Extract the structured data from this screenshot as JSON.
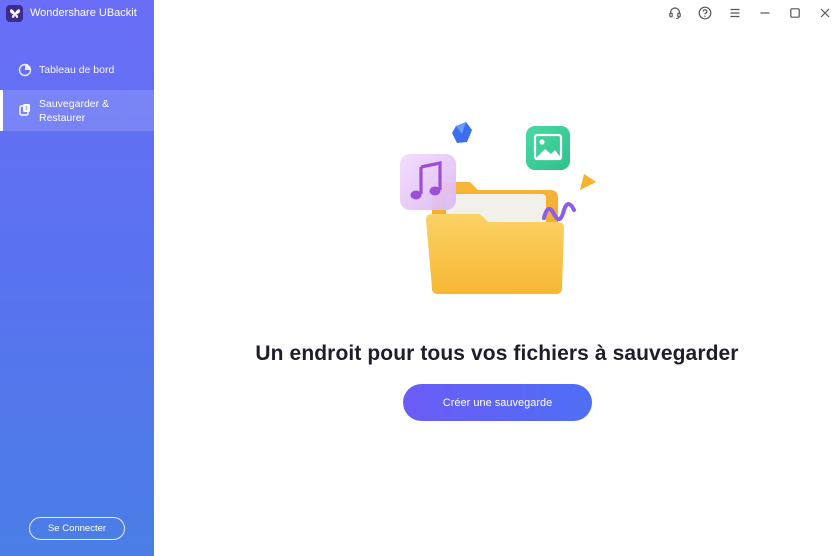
{
  "app": {
    "name": "Wondershare UBackit",
    "logo_icon": "butterfly-logo"
  },
  "sidebar": {
    "items": [
      {
        "label": "Tableau de bord",
        "icon": "dashboard-icon",
        "active": false
      },
      {
        "label": "Sauvegarder & Restaurer",
        "icon": "backup-restore-icon",
        "active": true
      }
    ],
    "connect_label": "Se Connecter"
  },
  "titlebar": {
    "icons": [
      "headset-icon",
      "help-icon",
      "menu-icon",
      "minimize-icon",
      "maximize-icon",
      "close-icon"
    ]
  },
  "main": {
    "headline": "Un endroit pour tous vos fichiers à sauvegarder",
    "cta_label": "Créer une sauvegarde"
  },
  "colors": {
    "sidebar_top": "#6a6ef7",
    "sidebar_bottom": "#4a7ee6",
    "cta_start": "#6b5cf6",
    "cta_end": "#4f6ef5",
    "folder": "#f7b733",
    "image_tile": "#3ecf9a",
    "music_tile": "#e8cdf7"
  }
}
